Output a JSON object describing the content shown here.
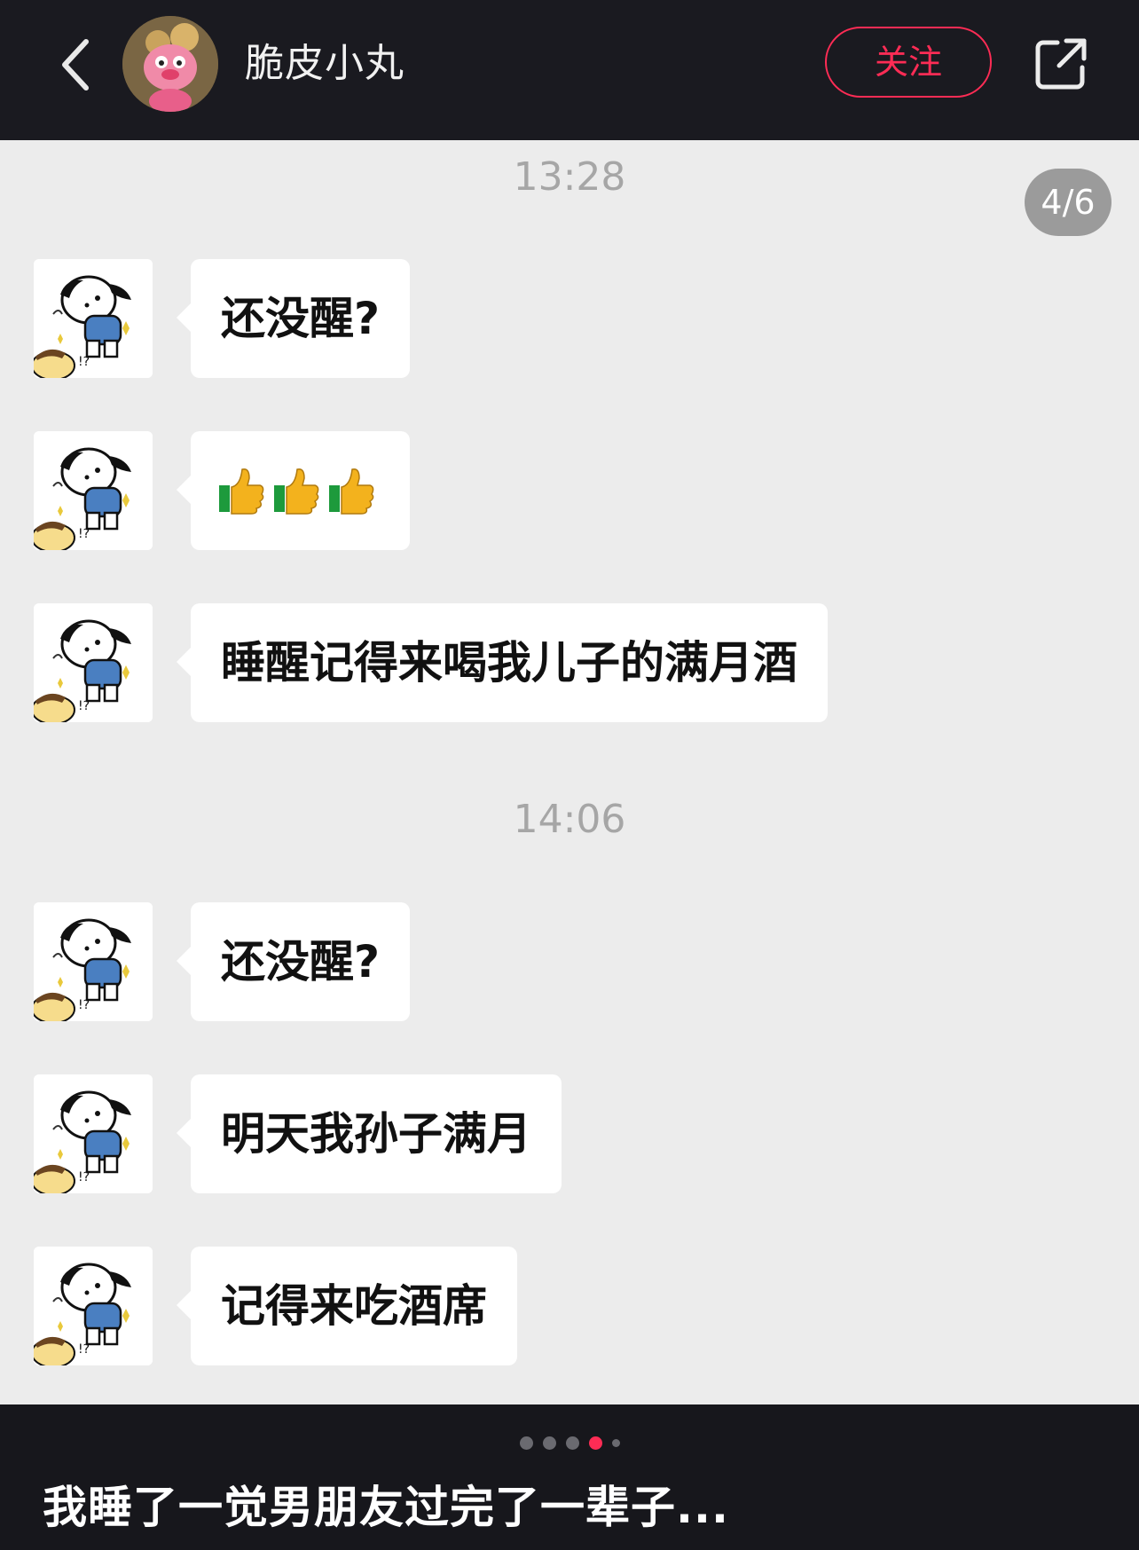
{
  "header": {
    "back_icon": "chevron-left-icon",
    "user_name": "脆皮小丸",
    "follow_label": "关注",
    "share_icon": "share-external-icon",
    "accent_color": "#fe2c55"
  },
  "page_counter": "4/6",
  "chat": {
    "timestamps": [
      "13:28",
      "14:06"
    ],
    "messages": [
      {
        "text": "还没醒?"
      },
      {
        "text": "👍👍👍",
        "type": "emoji"
      },
      {
        "text": "睡醒记得来喝我儿子的满月酒"
      },
      {
        "text": "还没醒?"
      },
      {
        "text": "明天我孙子满月"
      },
      {
        "text": "记得来吃酒席"
      }
    ]
  },
  "carousel": {
    "total": 5,
    "active_index": 3
  },
  "caption": "我睡了一觉男朋友过完了一辈子..."
}
